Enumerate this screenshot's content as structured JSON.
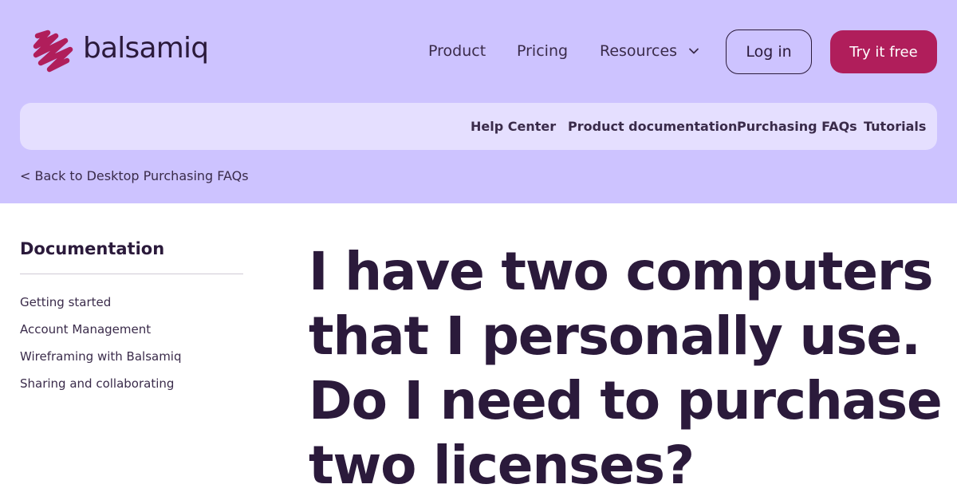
{
  "brand": {
    "name": "balsamiq",
    "accent": "#b01e5b",
    "header_bg": "#cdc3ff",
    "subnav_bg": "#e5dfff",
    "text": "#2b1a3b"
  },
  "topnav": {
    "product": "Product",
    "pricing": "Pricing",
    "resources": "Resources",
    "resources_icon": "chevron-down-icon",
    "login": "Log in",
    "try_free": "Try it free"
  },
  "subnav": {
    "items": [
      {
        "label": "Help Center"
      },
      {
        "label": "Product documentation"
      },
      {
        "label": "Purchasing FAQs"
      },
      {
        "label": "Tutorials"
      }
    ]
  },
  "breadcrumb": {
    "back": "< Back to Desktop Purchasing FAQs"
  },
  "sidebar": {
    "title": "Documentation",
    "items": [
      {
        "label": "Getting started"
      },
      {
        "label": "Account Management"
      },
      {
        "label": "Wireframing with Balsamiq"
      },
      {
        "label": "Sharing and collaborating"
      }
    ]
  },
  "main": {
    "title": "I have two computers that I personally use. Do I need to purchase two licenses?"
  }
}
